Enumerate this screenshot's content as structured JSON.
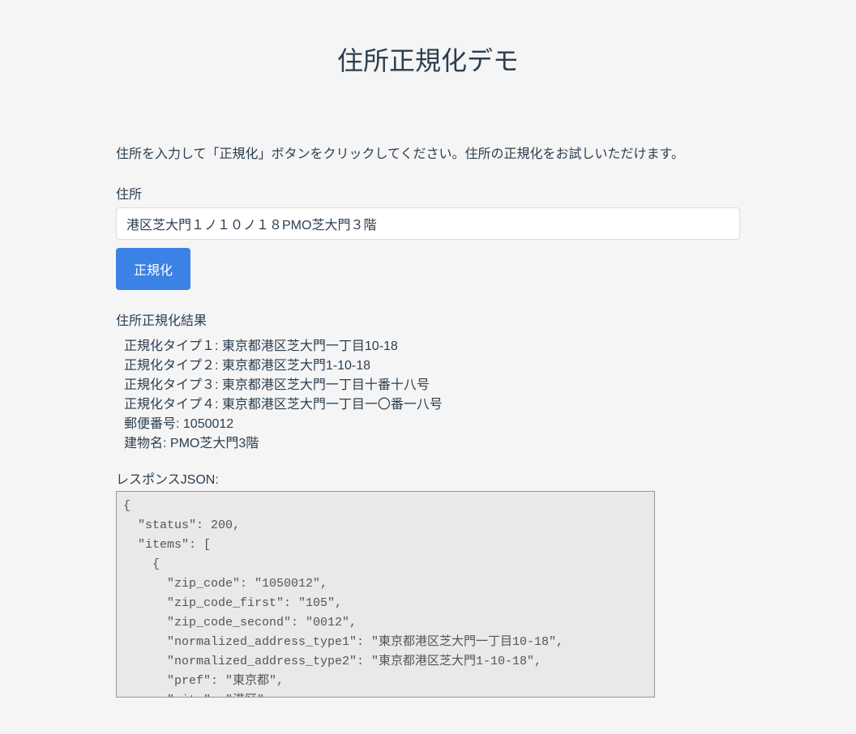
{
  "title": "住所正規化デモ",
  "instructions": "住所を入力して「正規化」ボタンをクリックしてください。住所の正規化をお試しいただけます。",
  "form": {
    "address_label": "住所",
    "address_value": "港区芝大門１ノ１０ノ１８PMO芝大門３階",
    "button_label": "正規化"
  },
  "result": {
    "header": "住所正規化結果",
    "items": [
      "正規化タイプ１: 東京都港区芝大門一丁目10-18",
      "正規化タイプ２: 東京都港区芝大門1-10-18",
      "正規化タイプ３: 東京都港区芝大門一丁目十番十八号",
      "正規化タイプ４: 東京都港区芝大門一丁目一〇番一八号",
      "郵便番号: 1050012",
      "建物名: PMO芝大門3階"
    ],
    "json_label": "レスポンスJSON:",
    "json_text": "{\n  \"status\": 200,\n  \"items\": [\n    {\n      \"zip_code\": \"1050012\",\n      \"zip_code_first\": \"105\",\n      \"zip_code_second\": \"0012\",\n      \"normalized_address_type1\": \"東京都港区芝大門一丁目10-18\",\n      \"normalized_address_type2\": \"東京都港区芝大門1-10-18\",\n      \"pref\": \"東京都\",\n      \"city\": \"港区\","
  }
}
